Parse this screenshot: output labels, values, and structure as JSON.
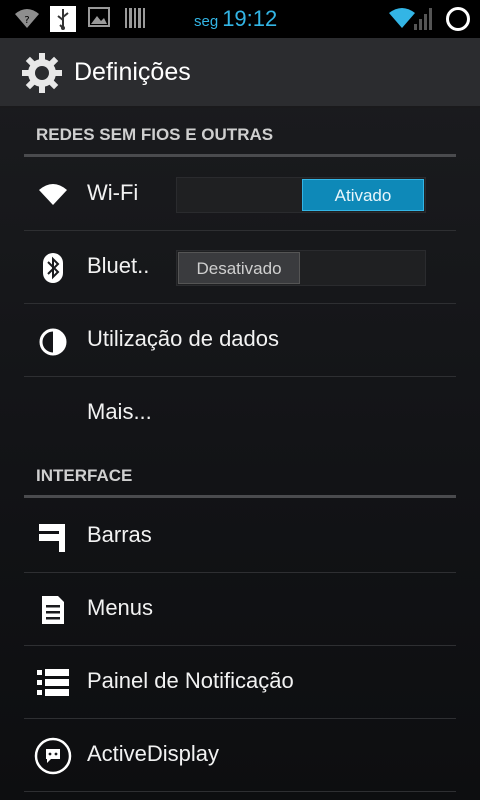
{
  "status_bar": {
    "day": "seg",
    "time": "19:12",
    "accent_color": "#33b5e5",
    "icons": [
      "wifi-icon",
      "usb-icon",
      "image-icon",
      "barcode-icon",
      "wifi-signal-icon",
      "cell-signal-icon",
      "ring-icon"
    ]
  },
  "action_bar": {
    "title": "Definições",
    "icon": "gear-icon"
  },
  "sections": [
    {
      "header": "REDES SEM FIOS E OUTRAS",
      "items": [
        {
          "label": "Wi-Fi",
          "icon": "wifi-icon",
          "toggle": "Ativado",
          "toggle_state": "on"
        },
        {
          "label": "Bluet..",
          "icon": "bluetooth-icon",
          "toggle": "Desativado",
          "toggle_state": "off"
        },
        {
          "label": "Utilização de dados",
          "icon": "data-usage-icon"
        },
        {
          "label": "Mais...",
          "icon": ""
        }
      ]
    },
    {
      "header": "INTERFACE",
      "items": [
        {
          "label": "Barras",
          "icon": "bars-icon"
        },
        {
          "label": "Menus",
          "icon": "menus-icon"
        },
        {
          "label": "Painel de Notificação",
          "icon": "list-icon"
        },
        {
          "label": "ActiveDisplay",
          "icon": "chat-icon"
        }
      ]
    }
  ]
}
